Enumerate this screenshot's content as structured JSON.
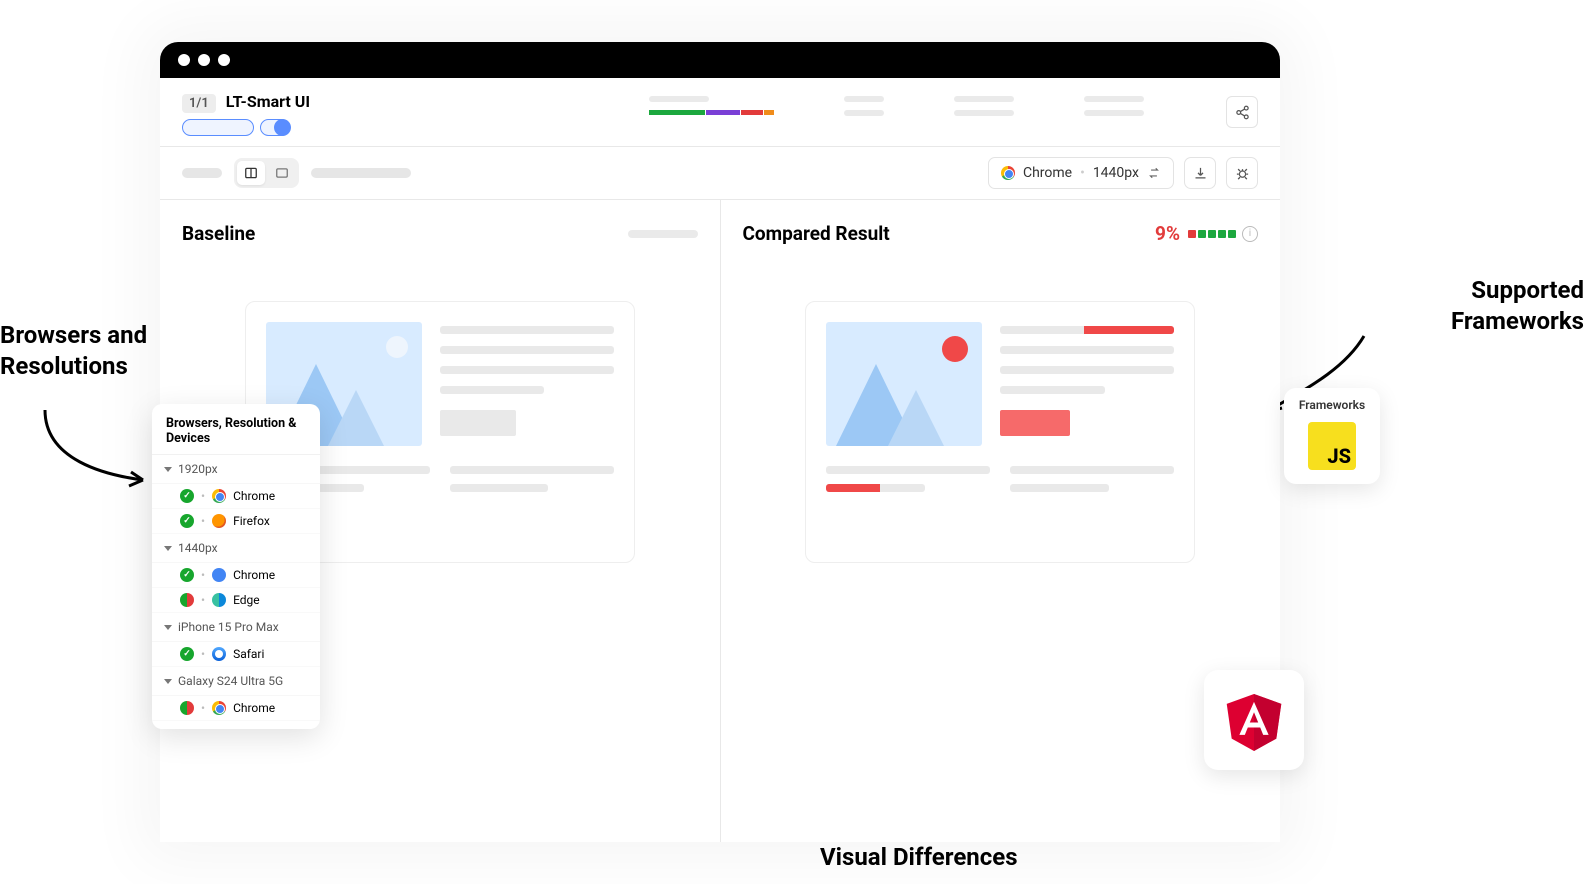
{
  "annotations": {
    "browsers": "Browsers and\nResolutions",
    "frameworks": "Supported\nFrameworks",
    "visdiff": "Visual Differences"
  },
  "header": {
    "count_badge": "1/1",
    "project_title": "LT-Smart UI"
  },
  "toolbar": {
    "browser_chip": "Chrome",
    "resolution_chip": "1440px"
  },
  "panes": {
    "baseline": {
      "title": "Baseline"
    },
    "compared": {
      "title": "Compared Result",
      "diff_pct": "9%"
    }
  },
  "popover": {
    "title": "Browsers, Resolution & Devices",
    "groups": [
      {
        "label": "1920px",
        "items": [
          {
            "status": "pass",
            "browser": "Chrome",
            "icon": "chrome"
          },
          {
            "status": "pass",
            "browser": "Firefox",
            "icon": "firefox"
          }
        ]
      },
      {
        "label": "1440px",
        "items": [
          {
            "status": "pass",
            "browser": "Chrome",
            "icon": "chrome-blue"
          },
          {
            "status": "mixed",
            "browser": "Edge",
            "icon": "edge"
          }
        ]
      },
      {
        "label": "iPhone 15 Pro Max",
        "items": [
          {
            "status": "pass",
            "browser": "Safari",
            "icon": "safari"
          }
        ]
      },
      {
        "label": "Galaxy S24 Ultra 5G",
        "items": [
          {
            "status": "mixed",
            "browser": "Chrome",
            "icon": "chrome"
          }
        ]
      }
    ]
  },
  "frameworks_card": {
    "label": "Frameworks",
    "js_label": "JS"
  }
}
